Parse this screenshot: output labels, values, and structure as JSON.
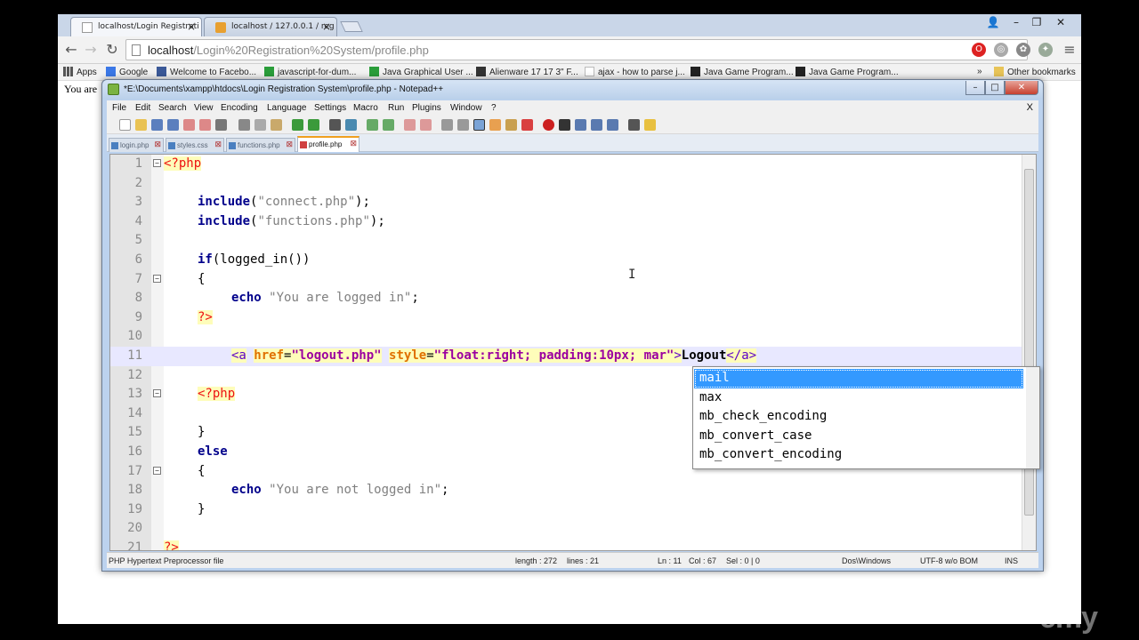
{
  "browser": {
    "tabs": [
      {
        "title": "localhost/Login Registrati",
        "active": true
      },
      {
        "title": "localhost / 127.0.0.1 / reg",
        "active": false
      }
    ],
    "window_controls": {
      "user": "👤",
      "minimize": "–",
      "maximize": "❐",
      "close": "✕"
    },
    "address": {
      "host": "localhost",
      "path": "/Login%20Registration%20System/profile.php"
    },
    "bookmarks": [
      {
        "label": "Apps"
      },
      {
        "label": "Google"
      },
      {
        "label": "Welcome to Facebo..."
      },
      {
        "label": "javascript-for-dum..."
      },
      {
        "label": "Java Graphical User ..."
      },
      {
        "label": "Alienware 17 17 3\" F..."
      },
      {
        "label": "ajax - how to parse j..."
      },
      {
        "label": "Java Game Program..."
      },
      {
        "label": "Java Game Program..."
      }
    ],
    "bookmarks_overflow": "»",
    "other_bookmarks": "Other bookmarks",
    "page_text": "You are"
  },
  "notepad": {
    "title": "*E:\\Documents\\xampp\\htdocs\\Login Registration System\\profile.php - Notepad++",
    "menu": [
      "File",
      "Edit",
      "Search",
      "View",
      "Encoding",
      "Language",
      "Settings",
      "Macro",
      "Run",
      "Plugins",
      "Window",
      "?"
    ],
    "doc_close": "X",
    "file_tabs": [
      {
        "name": "login.php",
        "active": false
      },
      {
        "name": "styles.css",
        "active": false
      },
      {
        "name": "functions.php",
        "active": false
      },
      {
        "name": "profile.php",
        "active": true
      }
    ],
    "lines": [
      {
        "n": "1"
      },
      {
        "n": "2"
      },
      {
        "n": "3"
      },
      {
        "n": "4"
      },
      {
        "n": "5"
      },
      {
        "n": "6"
      },
      {
        "n": "7"
      },
      {
        "n": "8"
      },
      {
        "n": "9"
      },
      {
        "n": "10"
      },
      {
        "n": "11"
      },
      {
        "n": "12"
      },
      {
        "n": "13"
      },
      {
        "n": "14"
      },
      {
        "n": "15"
      },
      {
        "n": "16"
      },
      {
        "n": "17"
      },
      {
        "n": "18"
      },
      {
        "n": "19"
      },
      {
        "n": "20"
      },
      {
        "n": "21"
      }
    ],
    "code": {
      "l1_open": "<?php",
      "l3_kw": "include",
      "l3_paren": "(",
      "l3_str": "\"connect.php\"",
      "l3_end": ");",
      "l4_kw": "include",
      "l4_paren": "(",
      "l4_str": "\"functions.php\"",
      "l4_end": ");",
      "l6_kw": "if",
      "l6_rest": "(logged_in())",
      "l7": "{",
      "l8_kw": "echo",
      "l8_str": "\"You are logged in\"",
      "l8_end": ";",
      "l9": "?>",
      "l11_tag": "<a",
      "l11_attr1": "href",
      "l11_eq1": "=",
      "l11_val1": "\"logout.php\"",
      "l11_attr2": "style",
      "l11_eq2": "=",
      "l11_val2": "\"float:right; padding:10px; mar\"",
      "l11_gt": ">",
      "l11_text": "Logout",
      "l11_close": "</a>",
      "l13": "<?php",
      "l15": "}",
      "l16_kw": "else",
      "l17": "{",
      "l18_kw": "echo",
      "l18_str": "\"You are not logged in\"",
      "l18_end": ";",
      "l19": "}",
      "l21": "?>"
    },
    "autocomplete": [
      "mail",
      "max",
      "mb_check_encoding",
      "mb_convert_case",
      "mb_convert_encoding"
    ],
    "status": {
      "filetype": "PHP Hypertext Preprocessor file",
      "length": "length : 272",
      "lines": "lines : 21",
      "position": "Ln : 11",
      "col": "Col : 67",
      "sel": "Sel : 0 | 0",
      "eol": "Dos\\Windows",
      "encoding": "UTF-8 w/o BOM",
      "mode": "INS"
    }
  },
  "watermark": "emy",
  "colors": {
    "keyword": "#00008b",
    "string": "#808080",
    "php_tag": "#ee1111",
    "html_attr": "#e07000",
    "selection": "#3399ff"
  }
}
